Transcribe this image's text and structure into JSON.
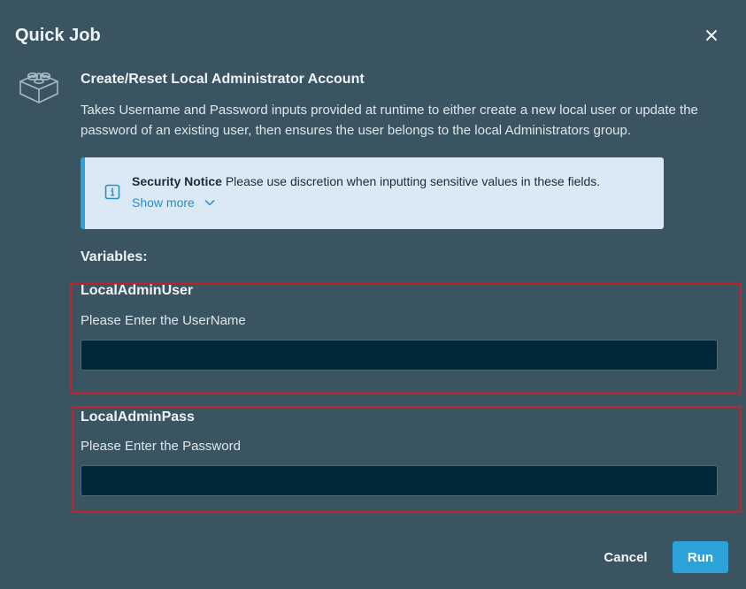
{
  "dialog": {
    "title": "Quick Job",
    "close_icon": "close-icon"
  },
  "job": {
    "icon": "lego-brick-icon",
    "name": "Create/Reset Local Administrator Account",
    "description": "Takes Username and Password inputs provided at runtime to either create a new local user or update the password of an existing user, then ensures the user belongs to the local Administrators group."
  },
  "notice": {
    "icon": "info-icon",
    "title": "Security Notice",
    "text": "Please use discretion when inputting sensitive values in these fields.",
    "show_more": "Show more",
    "accent_color": "#2ba3d9",
    "background_color": "#dbe9f5"
  },
  "variables": {
    "label": "Variables:",
    "items": [
      {
        "name": "LocalAdminUser",
        "prompt": "Please Enter the UserName",
        "value": ""
      },
      {
        "name": "LocalAdminPass",
        "prompt": "Please Enter the Password",
        "value": ""
      }
    ],
    "highlight_color": "#c62028"
  },
  "footer": {
    "cancel_label": "Cancel",
    "run_label": "Run",
    "run_color": "#2ba3d9"
  }
}
